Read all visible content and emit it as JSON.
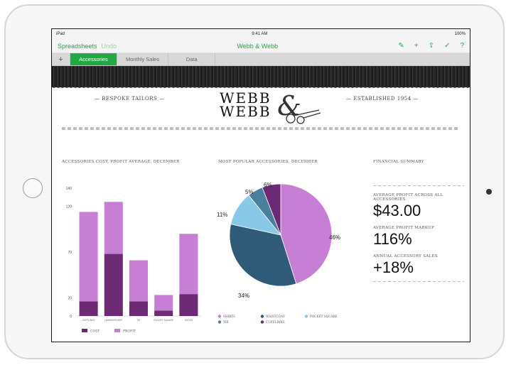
{
  "status": {
    "carrier": "iPad",
    "time": "9:41 AM",
    "battery": "100%"
  },
  "toolbar": {
    "back": "Spreadsheets",
    "undo": "Undo",
    "title": "Webb & Webb",
    "icons": [
      "brush-icon",
      "plus-icon",
      "share-icon",
      "wrench-icon",
      "help-icon"
    ],
    "accent": "#23a846"
  },
  "tabs": {
    "add": "+",
    "items": [
      "Accessories",
      "Monthly Sales",
      "Data"
    ]
  },
  "header": {
    "left_tag": "— BESPOKE TAILORS —",
    "logo_line1": "WEBB",
    "logo_line2": "WEBB",
    "amp": "&",
    "right_tag": "— ESTABLISHED 1954 —"
  },
  "bar_section": {
    "title": "ACCESSORIES COST, PROFIT AVERAGE, DECEMBER"
  },
  "pie_section": {
    "title": "MOST POPULAR ACCESSORIES, DECEMBER"
  },
  "summary": {
    "title": "FINANCIAL SUMMARY",
    "profit_label": "AVERAGE PROFIT ACROSS ALL ACCESSORIES",
    "profit_value": "$43.00",
    "markup_label": "AVERAGE PROFIT MARKUP",
    "markup_value": "116%",
    "sales_label": "ANNUAL ACCESSORY SALES",
    "sales_value": "+18%"
  },
  "chart_data": [
    {
      "type": "bar",
      "stacked": true,
      "categories": [
        "CUFFLINKS",
        "HANDKERCHIEF",
        "TIE",
        "POCKET SQUARE",
        "SOCKS"
      ],
      "series": [
        {
          "name": "COST",
          "values": [
            16,
            68,
            16,
            6,
            24
          ],
          "color": "#6b2a73"
        },
        {
          "name": "PROFIT",
          "values": [
            98,
            57,
            45,
            17,
            66
          ],
          "color": "#c77fd6"
        }
      ],
      "yticks": [
        0,
        20,
        70,
        120,
        140
      ],
      "ylim": [
        0,
        140
      ]
    },
    {
      "type": "pie",
      "slices": [
        {
          "name": "SHIRTS",
          "value": 46,
          "label": "46%",
          "color": "#c77fd6"
        },
        {
          "name": "WAISTCOAT",
          "value": 34,
          "label": "34%",
          "color": "#2f5a78"
        },
        {
          "name": "POCKET SQUARE",
          "value": 11,
          "label": "11%",
          "color": "#89c8e6"
        },
        {
          "name": "TIE",
          "value": 5,
          "label": "5%",
          "color": "#4b7f9e"
        },
        {
          "name": "CUFFLINKS",
          "value": 6,
          "label": "6%",
          "color": "#6b2a73"
        }
      ]
    }
  ]
}
